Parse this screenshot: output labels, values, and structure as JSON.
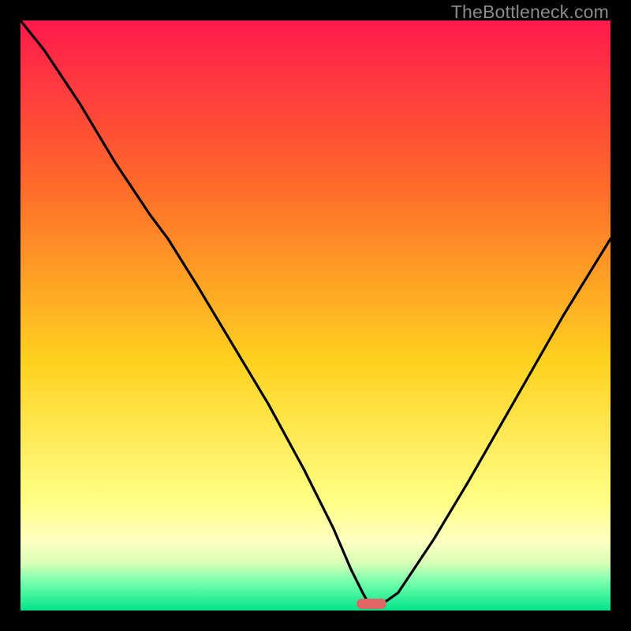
{
  "watermark": "TheBottleneck.com",
  "colors": {
    "top": "#ff1a4c",
    "mid_upper": "#ff6a2a",
    "mid": "#ffd21f",
    "mid_lower": "#ffff88",
    "band_light": "#ffffc0",
    "band_pale_green": "#d8ffb8",
    "band_green": "#7affad",
    "bottom": "#00e58a",
    "curve": "#000000",
    "marker": "#e06666"
  },
  "chart_data": {
    "type": "line",
    "title": "",
    "xlabel": "",
    "ylabel": "",
    "xlim": [
      0,
      100
    ],
    "ylim": [
      0,
      100
    ],
    "series": [
      {
        "name": "bottleneck-curve",
        "x": [
          0,
          4,
          10,
          16,
          22,
          25,
          30,
          36,
          42,
          48,
          53,
          56,
          58,
          59,
          60,
          62,
          64,
          66,
          70,
          76,
          84,
          92,
          100
        ],
        "values": [
          100,
          95,
          86,
          76,
          67,
          63,
          55,
          45,
          35,
          24,
          14,
          7,
          3,
          1.2,
          1.2,
          1.6,
          3,
          6,
          12,
          22,
          36,
          50,
          63
        ]
      }
    ],
    "annotations": [
      {
        "name": "min-marker",
        "x_range": [
          57,
          62
        ],
        "y": 1.2
      }
    ]
  }
}
